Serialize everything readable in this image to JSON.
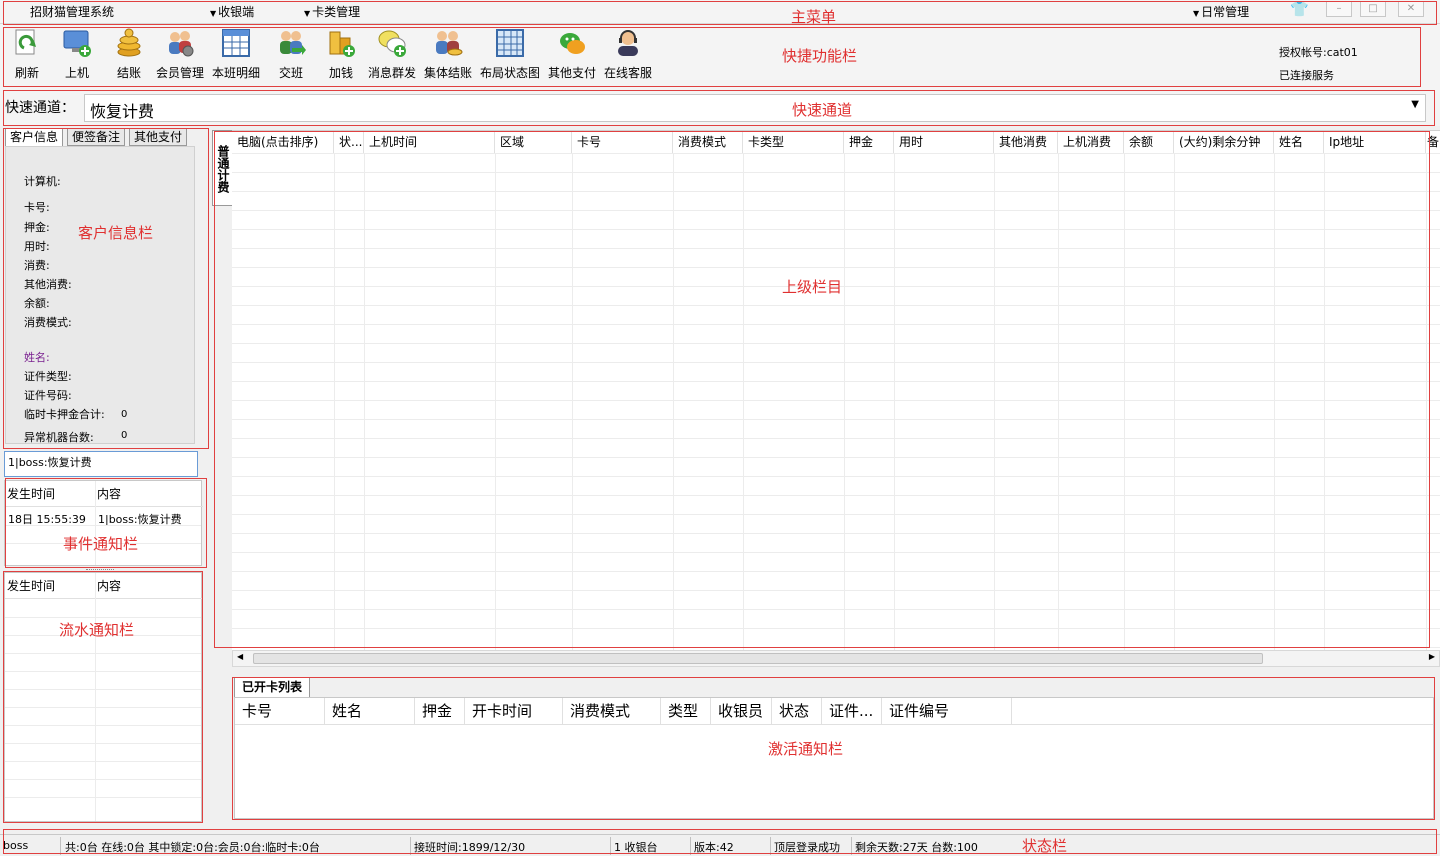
{
  "annotations": {
    "main_menu": "主菜单",
    "toolbar": "快捷功能栏",
    "quick_channel": "快速通道",
    "customer_info": "客户信息栏",
    "upper_columns": "上级栏目",
    "event_notice": "事件通知栏",
    "flow_notice": "流水通知栏",
    "activation_notice": "激活通知栏",
    "status_bar": "状态栏"
  },
  "menu": {
    "app_title": "招财猫管理系统",
    "cashier": "收银端",
    "card_mgmt": "卡类管理",
    "daily_mgmt": "日常管理"
  },
  "toolbar": {
    "items": [
      {
        "label": "刷新",
        "icon": "refresh-icon"
      },
      {
        "label": "上机",
        "icon": "computer-add-icon"
      },
      {
        "label": "结账",
        "icon": "coins-icon"
      },
      {
        "label": "会员管理",
        "icon": "members-gear-icon"
      },
      {
        "label": "本班明细",
        "icon": "grid-table-icon"
      },
      {
        "label": "交班",
        "icon": "handover-icon"
      },
      {
        "label": "加钱",
        "icon": "add-money-icon"
      },
      {
        "label": "消息群发",
        "icon": "messages-icon"
      },
      {
        "label": "集体结账",
        "icon": "group-checkout-icon"
      },
      {
        "label": "布局状态图",
        "icon": "layout-grid-icon"
      },
      {
        "label": "其他支付",
        "icon": "other-pay-icon"
      },
      {
        "label": "在线客服",
        "icon": "support-agent-icon"
      }
    ],
    "account": "授权帐号:cat01",
    "connection": "已连接服务"
  },
  "quick": {
    "label": "快速通道：",
    "value": "恢复计费"
  },
  "left_tabs": [
    "客户信息",
    "便签备注",
    "其他支付"
  ],
  "customer_info": {
    "computer": "计算机:",
    "card": "卡号:",
    "deposit": "押金:",
    "time_used": "用时:",
    "consumption": "消费:",
    "other_consumption": "其他消费:",
    "balance": "余额:",
    "mode": "消费模式:",
    "name": "姓名:",
    "id_type": "证件类型:",
    "id_number": "证件号码:",
    "temp_deposit_total": "临时卡押金合计:",
    "temp_deposit_total_value": "0",
    "abnormal_machines": "异常机器台数:",
    "abnormal_machines_value": "0"
  },
  "event_input": "1|boss:恢复计费",
  "event_grid": {
    "headers": [
      "发生时间",
      "内容"
    ],
    "rows": [
      [
        "18日 15:55:39",
        "1|boss:恢复计费"
      ]
    ]
  },
  "flow_grid": {
    "headers": [
      "发生时间",
      "内容"
    ]
  },
  "vertical_tab": "普通计费",
  "main_grid": {
    "columns": [
      "电脑(点击排序)",
      "状...",
      "上机时间",
      "区域",
      "卡号",
      "消费模式",
      "卡类型",
      "押金",
      "用时",
      "其他消费",
      "上机消费",
      "余额",
      "(大约)剩余分钟",
      "姓名",
      "Ip地址",
      "备"
    ]
  },
  "card_list": {
    "tab": "已开卡列表",
    "columns": [
      "卡号",
      "姓名",
      "押金",
      "开卡时间",
      "消费模式",
      "类型",
      "收银员",
      "状态",
      "证件...",
      "证件编号"
    ]
  },
  "status": {
    "user": "boss",
    "counts": "共:0台 在线:0台 其中锁定:0台:会员:0台:临时卡:0台",
    "shift_time": "接班时间:1899/12/30",
    "register": "1 收银台",
    "version": "版本:42",
    "login": "顶层登录成功",
    "remaining": "剩余天数:27天 台数:100"
  }
}
